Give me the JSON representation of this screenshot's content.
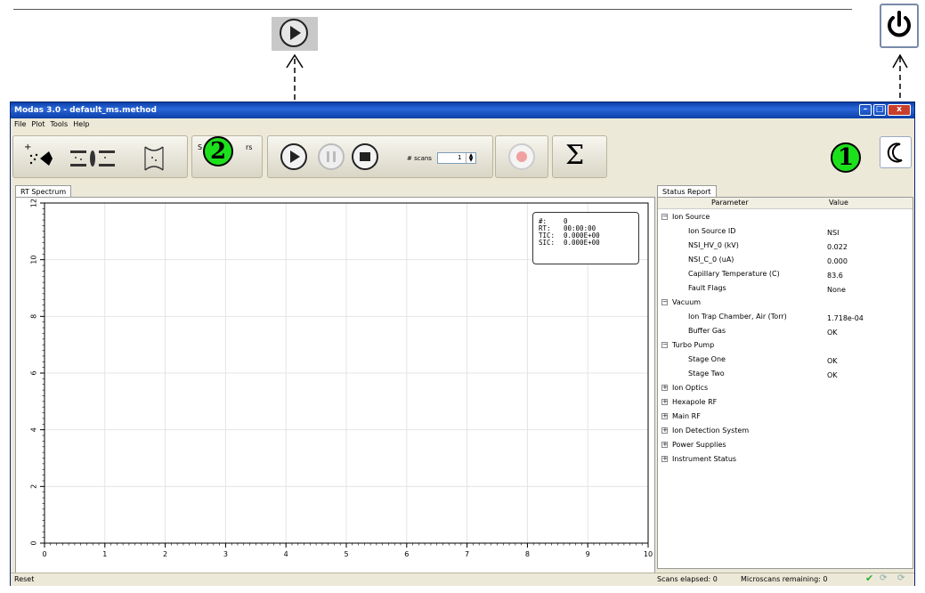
{
  "window": {
    "title": "Modas 3.0 - default_ms.method"
  },
  "menu": [
    "File",
    "Plot",
    "Tools",
    "Help"
  ],
  "toolbar": {
    "group_partial_label": "S",
    "group_partial_label_end": "rs",
    "scans_label": "# scans",
    "scans_value": "1",
    "sum_symbol": "Σ"
  },
  "markers": {
    "one": "1",
    "two": "2"
  },
  "tabs": {
    "rt_spectrum": "RT Spectrum",
    "status_report": "Status Report"
  },
  "chart_data": {
    "type": "line",
    "x_ticks": [
      "0",
      "1",
      "2",
      "3",
      "4",
      "5",
      "6",
      "7",
      "8",
      "9",
      "10"
    ],
    "y_ticks": [
      "0",
      "2",
      "4",
      "6",
      "8",
      "10",
      "12"
    ],
    "xlim": [
      0,
      10
    ],
    "ylim": [
      0,
      12
    ],
    "grid": true,
    "series": [],
    "info_box": {
      "rows": [
        {
          "label": "#:",
          "value": "0"
        },
        {
          "label": "RT:",
          "value": "00:00:00"
        },
        {
          "label": "TIC:",
          "value": "0.000E+00"
        },
        {
          "label": "SIC:",
          "value": "0.000E+00"
        }
      ]
    }
  },
  "status_report": {
    "columns": [
      "Parameter",
      "Value"
    ],
    "rows": [
      {
        "level": 0,
        "toggle": "−",
        "parameter": "Ion Source",
        "value": ""
      },
      {
        "level": 1,
        "toggle": "",
        "parameter": "Ion Source ID",
        "value": "NSI"
      },
      {
        "level": 1,
        "toggle": "",
        "parameter": "NSI_HV_0 (kV)",
        "value": "0.022"
      },
      {
        "level": 1,
        "toggle": "",
        "parameter": "NSI_C_0 (uA)",
        "value": "0.000"
      },
      {
        "level": 1,
        "toggle": "",
        "parameter": "Capillary Temperature (C)",
        "value": "83.6"
      },
      {
        "level": 1,
        "toggle": "",
        "parameter": "Fault Flags",
        "value": "None"
      },
      {
        "level": 0,
        "toggle": "−",
        "parameter": "Vacuum",
        "value": ""
      },
      {
        "level": 1,
        "toggle": "",
        "parameter": "Ion Trap Chamber, Air (Torr)",
        "value": "1.718e-04"
      },
      {
        "level": 1,
        "toggle": "",
        "parameter": "Buffer Gas",
        "value": "OK"
      },
      {
        "level": 0,
        "toggle": "−",
        "parameter": "Turbo Pump",
        "value": ""
      },
      {
        "level": 1,
        "toggle": "",
        "parameter": "Stage One",
        "value": "OK"
      },
      {
        "level": 1,
        "toggle": "",
        "parameter": "Stage Two",
        "value": "OK"
      },
      {
        "level": 0,
        "toggle": "+",
        "parameter": "Ion Optics",
        "value": ""
      },
      {
        "level": 0,
        "toggle": "+",
        "parameter": "Hexapole RF",
        "value": ""
      },
      {
        "level": 0,
        "toggle": "+",
        "parameter": "Main RF",
        "value": ""
      },
      {
        "level": 0,
        "toggle": "+",
        "parameter": "Ion Detection System",
        "value": ""
      },
      {
        "level": 0,
        "toggle": "+",
        "parameter": "Power Supplies",
        "value": ""
      },
      {
        "level": 0,
        "toggle": "+",
        "parameter": "Instrument Status",
        "value": ""
      }
    ]
  },
  "statusbar": {
    "left": "Reset",
    "scans_elapsed": "Scans elapsed: 0",
    "microscans_remaining": "Microscans remaining: 0"
  },
  "colors": {
    "marker_green": "#1de01d",
    "title_blue": "#0a3fa8",
    "check_green": "#2db02d"
  }
}
